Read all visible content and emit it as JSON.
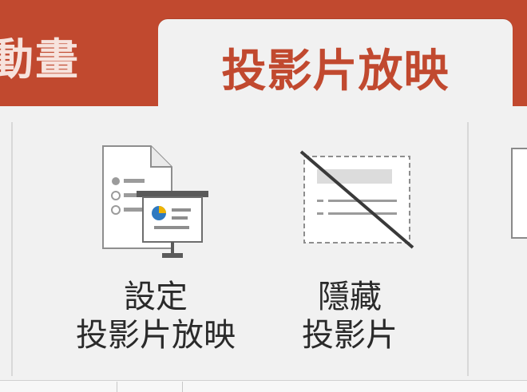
{
  "ribbon_tabs": {
    "previous_tab_label": "動畫",
    "active_tab_label": "投影片放映"
  },
  "buttons": {
    "setup_slideshow": {
      "line1": "設定",
      "line2": "投影片放映",
      "icon": "setup-slideshow-icon"
    },
    "hide_slide": {
      "line1": "隱藏",
      "line2": "投影片",
      "icon": "hide-slide-icon"
    }
  },
  "colors": {
    "tab_bar": "#c1492f",
    "active_tab_text": "#c1492f",
    "ribbon_bg": "#f1f1f1",
    "label_text": "#2a2a2a"
  }
}
